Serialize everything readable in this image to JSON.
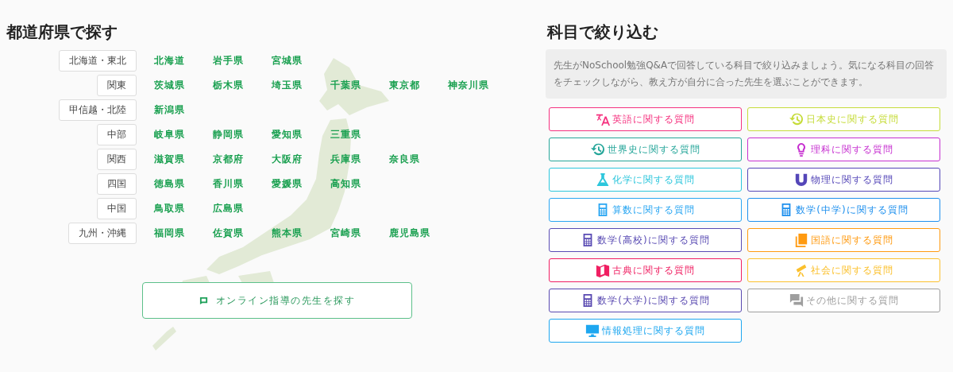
{
  "prefecture_section": {
    "title": "都道府県で探す",
    "regions": [
      {
        "label": "北海道・東北",
        "prefectures": [
          "北海道",
          "岩手県",
          "宮城県"
        ]
      },
      {
        "label": "関東",
        "prefectures": [
          "茨城県",
          "栃木県",
          "埼玉県",
          "千葉県",
          "東京都",
          "神奈川県"
        ]
      },
      {
        "label": "甲信越・北陸",
        "prefectures": [
          "新潟県"
        ]
      },
      {
        "label": "中部",
        "prefectures": [
          "岐阜県",
          "静岡県",
          "愛知県",
          "三重県"
        ]
      },
      {
        "label": "関西",
        "prefectures": [
          "滋賀県",
          "京都府",
          "大阪府",
          "兵庫県",
          "奈良県"
        ]
      },
      {
        "label": "四国",
        "prefectures": [
          "徳島県",
          "香川県",
          "愛媛県",
          "高知県"
        ]
      },
      {
        "label": "中国",
        "prefectures": [
          "鳥取県",
          "広島県"
        ]
      },
      {
        "label": "九州・沖縄",
        "prefectures": [
          "福岡県",
          "佐賀県",
          "熊本県",
          "宮崎県",
          "鹿児島県"
        ]
      }
    ],
    "online_button": "オンライン指導の先生を探す"
  },
  "subject_section": {
    "title": "科目で絞り込む",
    "description": "先生がNoSchool勉強Q&Aで回答している科目で絞り込みましょう。気になる科目の回答をチェックしながら、教え方が自分に合った先生を選ぶことができます。",
    "subjects": [
      {
        "label": "英語に関する質問",
        "kind": "translate",
        "color": "#f5317f"
      },
      {
        "label": "日本史に関する質問",
        "kind": "history",
        "color": "#c6dc3a"
      },
      {
        "label": "世界史に関する質問",
        "kind": "history",
        "color": "#26a69a"
      },
      {
        "label": "理科に関する質問",
        "kind": "bulb",
        "color": "#c62fd0"
      },
      {
        "label": "化学に関する質問",
        "kind": "flask",
        "color": "#2cc6dc"
      },
      {
        "label": "物理に関する質問",
        "kind": "magnet",
        "color": "#5446b8"
      },
      {
        "label": "算数に関する質問",
        "kind": "calculator",
        "color": "#2aa6f2"
      },
      {
        "label": "数学(中学)に関する質問",
        "kind": "calculator",
        "color": "#1e90ee"
      },
      {
        "label": "数学(高校)に関する質問",
        "kind": "calculator",
        "color": "#5a4cb4"
      },
      {
        "label": "国語に関する質問",
        "kind": "book",
        "color": "#ff9a10"
      },
      {
        "label": "古典に関する質問",
        "kind": "map",
        "color": "#f01f62"
      },
      {
        "label": "社会に関する質問",
        "kind": "telescope",
        "color": "#fbc02d"
      },
      {
        "label": "数学(大学)に関する質問",
        "kind": "calculator",
        "color": "#5848b0"
      },
      {
        "label": "その他に関する質問",
        "kind": "chat",
        "color": "#9e9e9e"
      },
      {
        "label": "情報処理に関する質問",
        "kind": "monitor",
        "color": "#1ea7f0"
      }
    ]
  }
}
